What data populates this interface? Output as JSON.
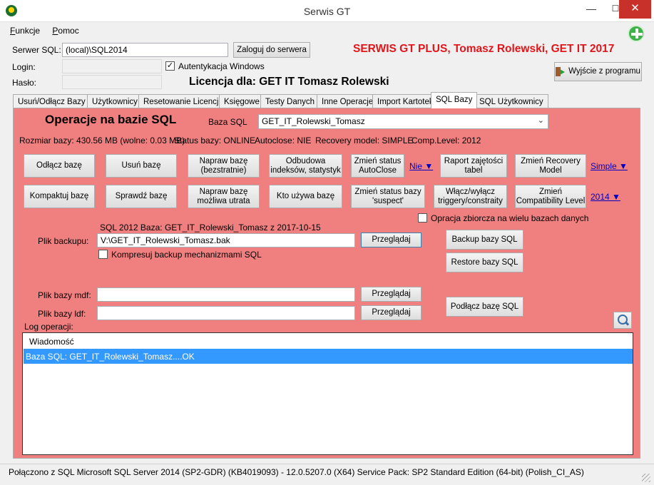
{
  "window": {
    "title": "Serwis GT",
    "min_glyph": "—",
    "max_glyph": "☐",
    "close_glyph": "✕"
  },
  "menu": [
    {
      "accel": "F",
      "rest": "unkcje"
    },
    {
      "accel": "P",
      "rest": "omoc"
    }
  ],
  "login": {
    "server_label": "Serwer SQL:",
    "server_value": "(local)\\SQL2014",
    "login_button": "Zaloguj do serwera",
    "login_label": "Login:",
    "password_label": "Hasło:",
    "windows_auth_label": "Autentykacja Windows",
    "windows_auth_checked": "✓"
  },
  "brand": "SERWIS GT PLUS, Tomasz Rolewski, GET IT 2017",
  "licence": "Licencja dla: GET IT Tomasz Rolewski",
  "exit_button": "Wyjście z programu",
  "tabs": [
    "Usuń/Odłącz Bazy",
    "Użytkownicy",
    "Resetowanie Licencji",
    "Księgowe",
    "Testy Danych",
    "Inne Operacje",
    "Import Kartotek",
    "SQL Bazy",
    "SQL Użytkownicy"
  ],
  "sql_panel": {
    "title": "Operacje na bazie SQL",
    "db_label": "Baza SQL",
    "db_selected": "GET_IT_Rolewski_Tomasz",
    "info": {
      "size": "Rozmiar bazy: 430.56 MB (wolne: 0.03 MB)",
      "status": "Status bazy: ONLINE",
      "autoclose": "Autoclose: NIE",
      "recovery": "Recovery model: SIMPLE",
      "comp_level": "Comp.Level: 2012"
    },
    "buttons": {
      "detach": "Odłącz bazę",
      "delete": "Usuń bazę",
      "repair_safe": "Napraw bazę\n(bezstratnie)",
      "rebuild": "Odbudowa\nindeksów, statystyk",
      "autoclose": "Zmień status\nAutoClose",
      "usage_report": "Raport zajętości\ntabel",
      "recovery": "Zmień Recovery\nModel",
      "compact": "Kompaktuj bazę",
      "check": "Sprawdź bazę",
      "repair_loss": "Napraw bazę\nmożliwa utrata",
      "who_uses": "Kto używa bazę",
      "suspect": "Zmień status bazy\n'suspect'",
      "triggers": "Włącz/wyłącz\ntriggery/constraity",
      "compat": "Zmień\nCompatibility Level",
      "browse": "Przeglądaj",
      "backup": "Backup bazy SQL",
      "restore": "Restore bazy SQL",
      "attach": "Podłącz bazę SQL"
    },
    "dropdown_links": {
      "autoclose": "Nie ▼",
      "recovery": "Simple ▼",
      "compat": "2014 ▼"
    },
    "bulk_label": "Opracja zbiorcza na wielu bazach danych",
    "backup_info": "SQL 2012  Baza: GET_IT_Rolewski_Tomasz z 2017-10-15",
    "backup_label": "Plik backupu:",
    "backup_value": "V:\\GET_IT_Rolewski_Tomasz.bak",
    "compress_label": "Kompresuj backup mechanizmami SQL",
    "mdf_label": "Plik bazy mdf:",
    "ldf_label": "Plik bazy ldf:",
    "log_label": "Log operacji:",
    "log_header": "Wiadomość",
    "log_rows": [
      "Baza SQL: GET_IT_Rolewski_Tomasz....OK"
    ]
  },
  "status_bar": "Połączono z SQL  Microsoft SQL Server 2014 (SP2-GDR) (KB4019093) - 12.0.5207.0 (X64)  Service Pack: SP2 Standard Edition (64-bit) (Polish_CI_AS)"
}
